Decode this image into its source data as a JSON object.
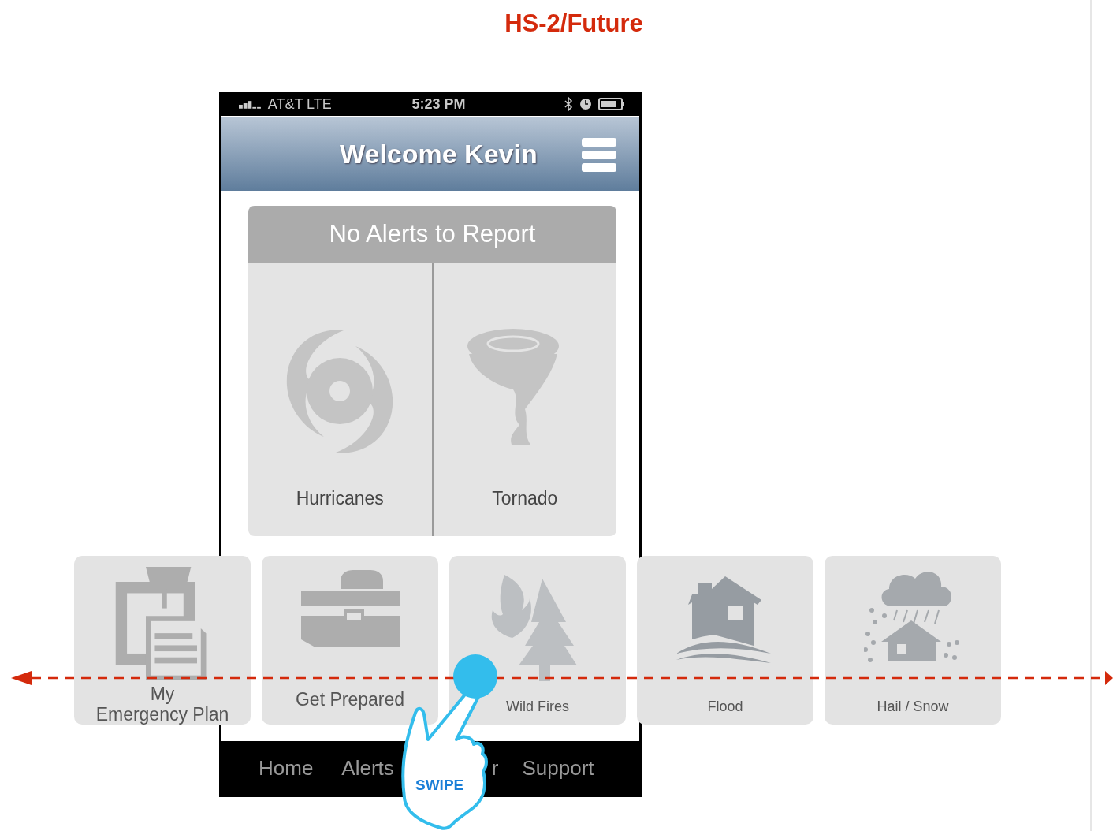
{
  "page_title": "HS-2/Future",
  "status_bar": {
    "carrier": "AT&T LTE",
    "time": "5:23 PM"
  },
  "header": {
    "title": "Welcome Kevin"
  },
  "alerts_panel": {
    "heading": "No Alerts to Report",
    "tiles": [
      {
        "label": "Hurricanes"
      },
      {
        "label": "Tornado"
      }
    ]
  },
  "carousel": [
    {
      "label": "My\nEmergency Plan",
      "kind": "large"
    },
    {
      "label": "Get Prepared",
      "kind": "large"
    },
    {
      "label": "Wild Fires",
      "kind": "small"
    },
    {
      "label": "Flood",
      "kind": "small"
    },
    {
      "label": "Hail / Snow",
      "kind": "small"
    }
  ],
  "bottom_nav": [
    {
      "label": "Home"
    },
    {
      "label": "Alerts"
    },
    {
      "label": "r"
    },
    {
      "label": "Support"
    }
  ],
  "swipe_hint": {
    "label": "SWIPE"
  }
}
